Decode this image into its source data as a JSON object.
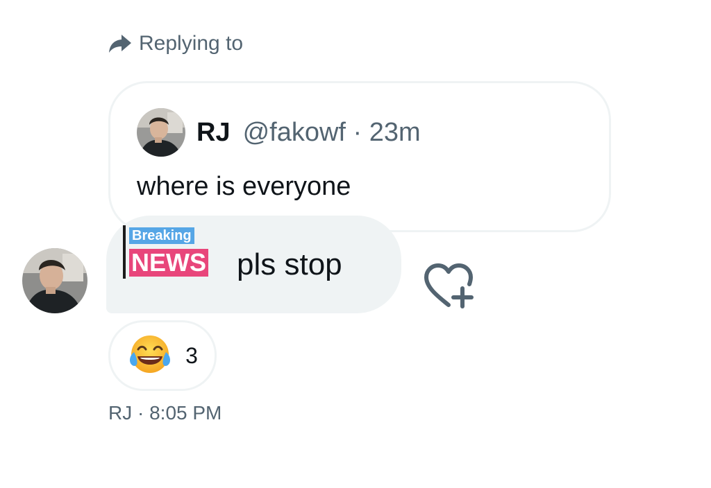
{
  "reply": {
    "prefix": "Replying to",
    "target": ""
  },
  "quoted": {
    "name": "RJ",
    "handle_time": "@fakowf · 23m",
    "text": "where is everyone"
  },
  "message": {
    "sticker_top": "Breaking",
    "sticker_bottom": "NEWS",
    "text": "pls stop"
  },
  "reaction": {
    "emoji": "face-with-tears-of-joy-icon",
    "count": "3"
  },
  "meta": {
    "sender_time": "RJ · 8:05 PM"
  },
  "colors": {
    "secondary_text": "#536471",
    "bubble_bg": "#eff3f4",
    "breaking_blue": "#56a6e6",
    "news_pink": "#e8467b"
  }
}
